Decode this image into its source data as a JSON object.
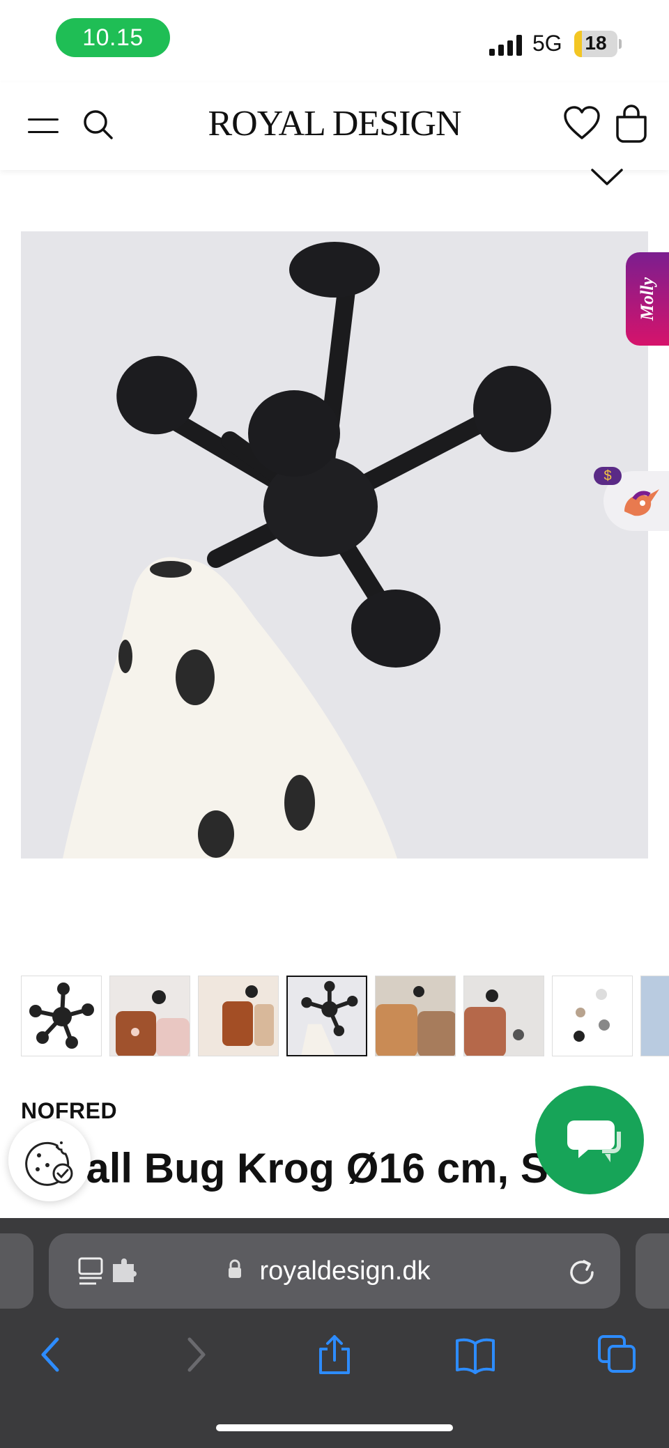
{
  "status_bar": {
    "time": "10.15",
    "network": "5G",
    "battery": "18",
    "battery_level": 0.18
  },
  "header": {
    "logo": "ROYAL DESIGN"
  },
  "widgets": {
    "molly_label": "Molly",
    "coin_symbol": "$"
  },
  "gallery": {
    "thumbnail_count": 8,
    "active_index": 3
  },
  "product": {
    "brand": "NOFRED",
    "title": "Small Bug Krog Ø16 cm, Sort"
  },
  "browser": {
    "url": "royaldesign.dk"
  },
  "icons": [
    "hamburger-icon",
    "search-icon",
    "heart-icon",
    "bag-icon",
    "chevron-down-icon",
    "cookie-icon",
    "chat-icon",
    "lock-icon",
    "reader-icon",
    "extension-icon",
    "reload-icon",
    "back-icon",
    "forward-icon",
    "share-icon",
    "bookmarks-icon",
    "tabs-icon"
  ],
  "colors": {
    "status_pill": "#1fbe55",
    "chat_button": "#17a458",
    "molly_gradient_start": "#7b1e8f",
    "molly_gradient_end": "#d6136b",
    "browser_blue": "#2d8cff",
    "browser_bg": "#3b3b3d"
  }
}
